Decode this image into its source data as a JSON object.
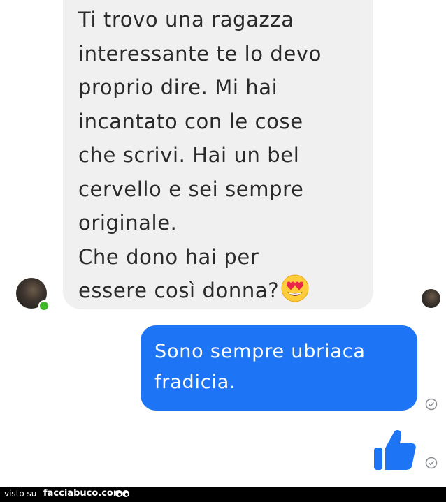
{
  "conversation": {
    "incoming_message": "Ti trovo una ragazza\ninteressante te lo devo\nproprio dire. Mi hai\nincantato con le cose\nche scrivi. Hai un bel\ncervello e sei sempre\noriginale.\nChe dono hai per\nessere così donna?",
    "outgoing_message": "Sono sempre ubriaca\nfradicia."
  },
  "icons": {
    "emoji": "heart-eyes-emoji",
    "like": "thumbs-up-icon",
    "seen": "check-circle-icon"
  },
  "colors": {
    "incoming_bubble": "#f1f0f0",
    "outgoing_bubble": "#1d74f5",
    "like": "#1d74f5",
    "online": "#42b72a"
  },
  "footer": {
    "prefix": "visto su",
    "site": "facciabuco.com"
  }
}
